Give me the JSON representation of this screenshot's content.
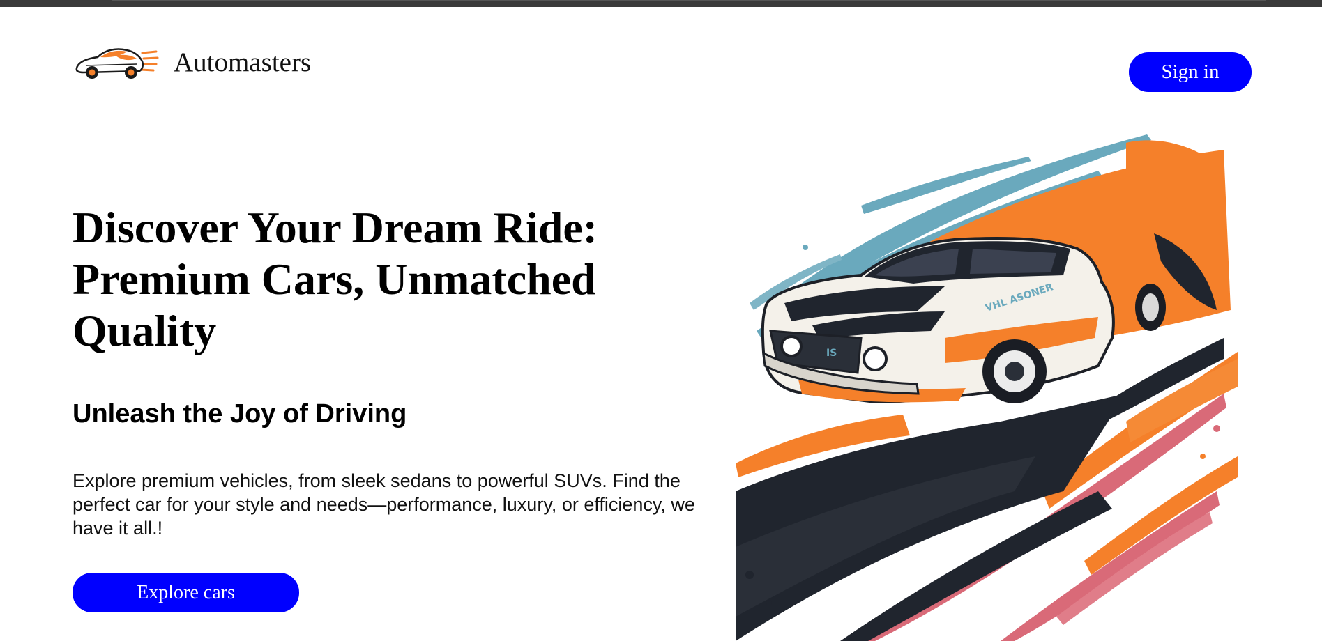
{
  "brand": {
    "name": "Automasters",
    "logo_icon": "car-logo-icon"
  },
  "header": {
    "signin_label": "Sign in"
  },
  "hero": {
    "title": "Discover Your Dream Ride: Premium Cars, Unmatched Quality",
    "subtitle": "Unleash the Joy of Driving",
    "body": "Explore premium vehicles, from sleek sedans to powerful SUVs. Find the perfect car for your style and needs—performance, luxury, or efficiency, we have it all.!",
    "cta_label": "Explore cars",
    "illustration": "muscle-car-illustration"
  },
  "colors": {
    "accent": "#0000ff",
    "orange": "#f5802a",
    "teal": "#6aa9bd",
    "pink": "#d96a78",
    "dark": "#20252e"
  }
}
